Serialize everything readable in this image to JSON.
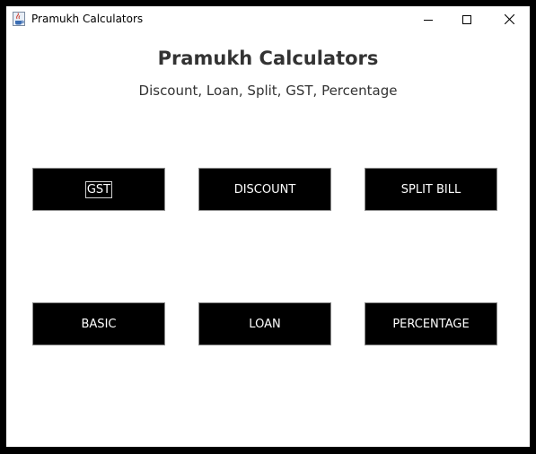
{
  "window": {
    "title": "Pramukh Calculators",
    "icons": {
      "app": "java-coffee-cup-icon",
      "minimize": "minimize-icon",
      "maximize": "maximize-icon",
      "close": "close-icon"
    }
  },
  "main": {
    "heading": "Pramukh Calculators",
    "subheading": "Discount, Loan, Split, GST, Percentage",
    "buttons": {
      "gst": "GST",
      "discount": "DISCOUNT",
      "split_bill": "SPLIT BILL",
      "basic": "BASIC",
      "loan": "LOAN",
      "percentage": "PERCENTAGE"
    },
    "focused_button": "GST"
  },
  "colors": {
    "button_background": "#000000",
    "button_text": "#ffffff",
    "heading_text": "#333333",
    "window_background": "#ffffff"
  }
}
